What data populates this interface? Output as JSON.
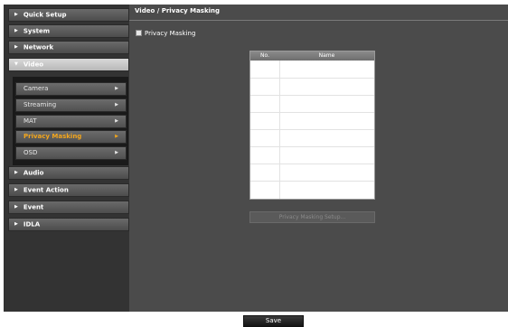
{
  "sidebar": {
    "items": [
      {
        "label": "Quick Setup",
        "icon": "caret-right-icon"
      },
      {
        "label": "System",
        "icon": "caret-right-icon"
      },
      {
        "label": "Network",
        "icon": "caret-right-icon"
      },
      {
        "label": "Video",
        "icon": "caret-down-icon"
      },
      {
        "label": "Audio",
        "icon": "caret-right-icon"
      },
      {
        "label": "Event Action",
        "icon": "caret-right-icon"
      },
      {
        "label": "Event",
        "icon": "caret-right-icon"
      },
      {
        "label": "IDLA",
        "icon": "caret-right-icon"
      }
    ],
    "submenu": [
      {
        "label": "Camera"
      },
      {
        "label": "Streaming"
      },
      {
        "label": "MAT"
      },
      {
        "label": "Privacy Masking"
      },
      {
        "label": "OSD"
      }
    ],
    "active_item": "Video",
    "active_subitem": "Privacy Masking"
  },
  "main": {
    "title": "Video / Privacy Masking",
    "checkbox_label": "Privacy Masking",
    "checkbox_checked": false,
    "table": {
      "columns": [
        "No.",
        "Name"
      ],
      "rows": []
    },
    "setup_button": "Privacy Masking Setup..."
  },
  "footer": {
    "save_label": "Save"
  },
  "colors": {
    "accent": "#f2a51c",
    "panel": "#4b4b4b",
    "sidebar": "#333333"
  }
}
